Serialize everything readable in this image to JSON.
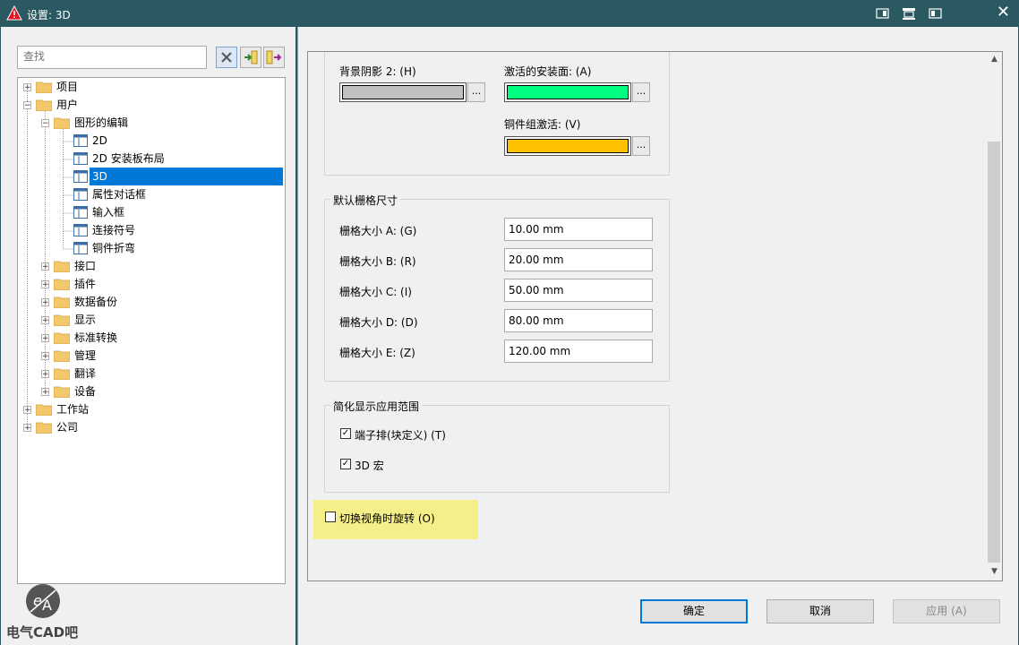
{
  "window": {
    "title": "设置: 3D",
    "close_glyph": "✕"
  },
  "search": {
    "placeholder": "查找"
  },
  "tree": [
    {
      "label": "项目",
      "expander": "+",
      "icon": "folder"
    },
    {
      "label": "用户",
      "expander": "−",
      "icon": "folder"
    },
    {
      "label": "图形的编辑",
      "expander": "−",
      "icon": "folder"
    },
    {
      "label": "2D",
      "icon": "page"
    },
    {
      "label": "2D 安装板布局",
      "icon": "page"
    },
    {
      "label": "3D",
      "icon": "page",
      "selected": true
    },
    {
      "label": "属性对话框",
      "icon": "page"
    },
    {
      "label": "输入框",
      "icon": "page"
    },
    {
      "label": "连接符号",
      "icon": "page"
    },
    {
      "label": "铜件折弯",
      "icon": "page"
    },
    {
      "label": "接口",
      "expander": "+",
      "icon": "folder"
    },
    {
      "label": "插件",
      "expander": "+",
      "icon": "folder"
    },
    {
      "label": "数据备份",
      "expander": "+",
      "icon": "folder"
    },
    {
      "label": "显示",
      "expander": "+",
      "icon": "folder"
    },
    {
      "label": "标准转换",
      "expander": "+",
      "icon": "folder"
    },
    {
      "label": "管理",
      "expander": "+",
      "icon": "folder"
    },
    {
      "label": "翻译",
      "expander": "+",
      "icon": "folder"
    },
    {
      "label": "设备",
      "expander": "+",
      "icon": "folder"
    },
    {
      "label": "工作站",
      "expander": "+",
      "icon": "folder"
    },
    {
      "label": "公司",
      "expander": "+",
      "icon": "folder"
    }
  ],
  "colors": {
    "bg_shadow_label": "背景阴影 2: (H)",
    "bg_shadow_color": "#c0c0c0",
    "active_plane_label": "激活的安装面: (A)",
    "active_plane_color": "#00ff80",
    "copper_active_label": "铜件组激活: (V)",
    "copper_active_color": "#ffc000",
    "dots": "..."
  },
  "grid": {
    "title": "默认栅格尺寸",
    "rows": [
      {
        "label": "栅格大小 A: (G)",
        "value": "10.00 mm"
      },
      {
        "label": "栅格大小 B: (R)",
        "value": "20.00 mm"
      },
      {
        "label": "栅格大小 C: (I)",
        "value": "50.00 mm"
      },
      {
        "label": "栅格大小 D: (D)",
        "value": "80.00 mm"
      },
      {
        "label": "栅格大小 E: (Z)",
        "value": "120.00 mm"
      }
    ]
  },
  "simplified": {
    "title": "简化显示应用范围",
    "terminal_label": "端子排(块定义) (T)",
    "terminal_checked": true,
    "macro_label": "3D 宏",
    "macro_checked": true,
    "check_glyph": "✓"
  },
  "rotate": {
    "label": "切换视角时旋转 (O)",
    "checked": false
  },
  "buttons": {
    "ok": "确定",
    "cancel": "取消",
    "apply": "应用 (A)"
  },
  "scroll": {
    "up": "▲",
    "down": "▼"
  },
  "watermark": {
    "logo_text": "电气CAD吧"
  }
}
